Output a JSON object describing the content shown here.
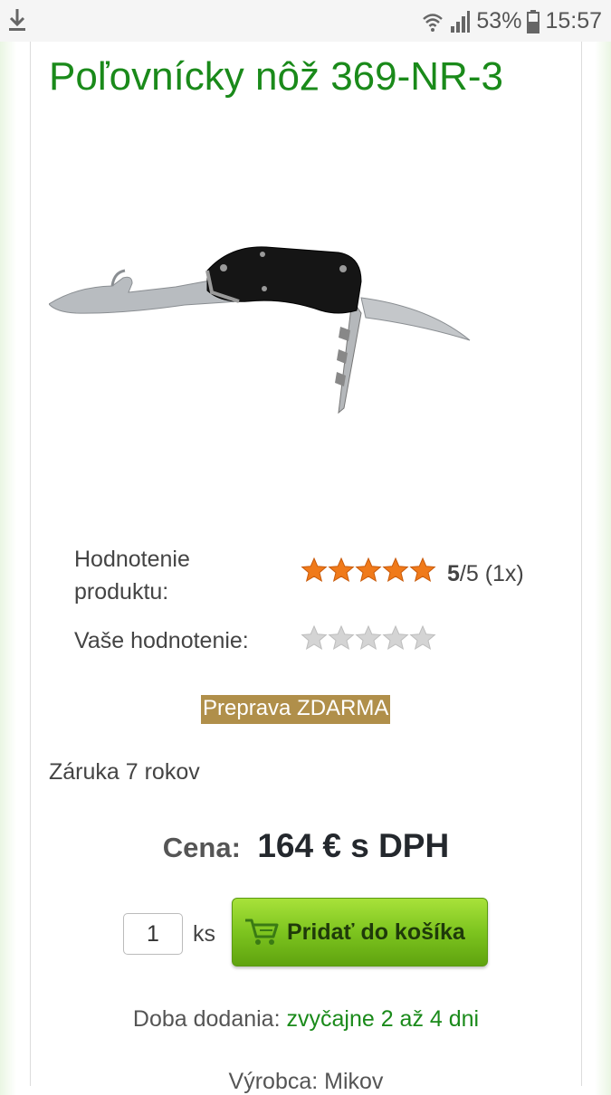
{
  "status_bar": {
    "battery": "53%",
    "time": "15:57"
  },
  "product": {
    "title": "Poľovnícky nôž 369-NR-3",
    "rating_label": "Hodnotenie produktu:",
    "rating_score": "5",
    "rating_suffix": "/5 (1x)",
    "rating_value": 5,
    "your_rating_label": "Vaše hodnotenie:",
    "shipping_badge": "Preprava ZDARMA",
    "warranty": "Záruka 7 rokov",
    "price_label": "Cena:",
    "price_value": "164 € s DPH",
    "quantity": "1",
    "quantity_unit": "ks",
    "add_to_cart": "Pridať do košíka",
    "delivery_label": "Doba dodania:",
    "delivery_value": "zvyčajne 2 až 4 dni",
    "manufacturer": "Výrobca: Mikov"
  },
  "colors": {
    "title": "#1a8a1a",
    "star_filled": "#f07a1a",
    "star_empty": "#d4d4d4",
    "shipping_bg": "#b08f4a",
    "button": "#7dc41f"
  }
}
